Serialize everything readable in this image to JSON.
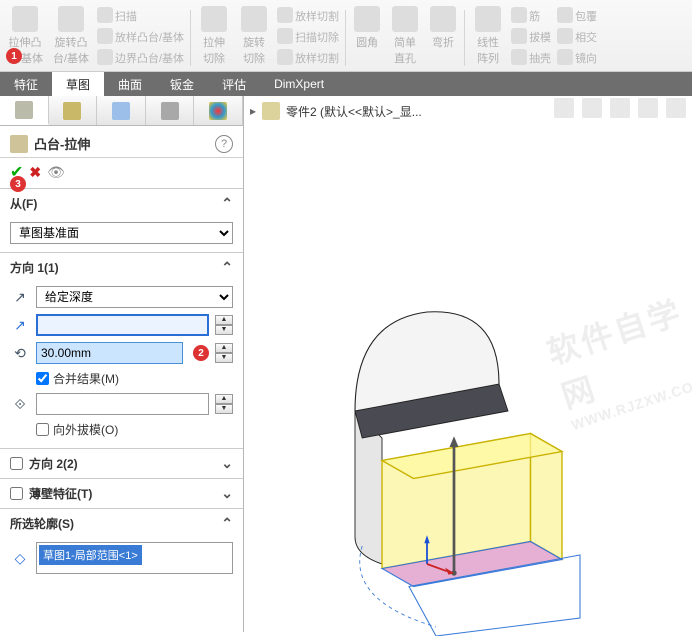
{
  "ribbon": {
    "extrude": "拉伸凸台/基体",
    "revolve": "旋转凸台/基体",
    "sweep": "扫描",
    "loft": "放样凸台/基体",
    "boundary": "边界凸台/基体",
    "cut_extrude": "拉伸切除",
    "cut_revolve": "旋转切除",
    "cut_loft": "放样切割",
    "cut_sweep": "扫描切除",
    "cut_loft2": "放样切割",
    "fillet": "圆角",
    "hole": "简单直孔",
    "bend": "弯折",
    "linpattern": "线性阵列",
    "rib": "筋",
    "draft": "拔模",
    "shell": "抽壳",
    "wrap": "包覆",
    "intersect": "相交",
    "mirror": "镜向"
  },
  "tabs": [
    "特征",
    "草图",
    "曲面",
    "钣金",
    "评估",
    "DimXpert"
  ],
  "activeTab": 1,
  "feature": {
    "title": "凸台-拉伸",
    "from_label": "从(F)",
    "from_value": "草图基准面",
    "dir_label": "方向 1(1)",
    "dir_type": "给定深度",
    "depth": "30.00mm",
    "merge": "合并结果(M)",
    "draft_out": "向外拔模(O)",
    "dir2": "方向 2(2)",
    "thin": "薄壁特征(T)",
    "contours": "所选轮廓(S)",
    "contour_item": "草图1-局部范围<1>"
  },
  "crumb": "零件2  (默认<<默认>_显...",
  "badges": {
    "n1": "1",
    "n2": "2",
    "n3": "3"
  },
  "watermark": "软件自学网",
  "watermark2": "WWW.RJZXW.COM"
}
